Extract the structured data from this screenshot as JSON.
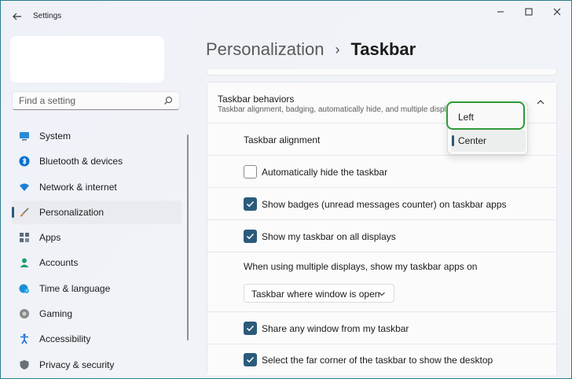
{
  "window": {
    "title": "Settings"
  },
  "search": {
    "placeholder": "Find a setting"
  },
  "sidebar": {
    "items": [
      {
        "label": "System",
        "icon": "monitor-icon",
        "color": "#0078d4"
      },
      {
        "label": "Bluetooth & devices",
        "icon": "bluetooth-icon",
        "color": "#0a6fd0"
      },
      {
        "label": "Network & internet",
        "icon": "wifi-icon",
        "color": "#1a7fd6"
      },
      {
        "label": "Personalization",
        "icon": "brush-icon",
        "color": "#d7742a",
        "active": true
      },
      {
        "label": "Apps",
        "icon": "apps-icon",
        "color": "#4d5b6b"
      },
      {
        "label": "Accounts",
        "icon": "person-icon",
        "color": "#1aa06a"
      },
      {
        "label": "Time & language",
        "icon": "globe-clock-icon",
        "color": "#1a8fd6"
      },
      {
        "label": "Gaming",
        "icon": "gamepad-icon",
        "color": "#6e6e6e"
      },
      {
        "label": "Accessibility",
        "icon": "accessibility-icon",
        "color": "#1a6fd6"
      },
      {
        "label": "Privacy & security",
        "icon": "shield-icon",
        "color": "#6b6f76"
      }
    ]
  },
  "breadcrumb": {
    "parent": "Personalization",
    "separator": "›",
    "current": "Taskbar"
  },
  "section": {
    "title": "Taskbar behaviors",
    "subtitle": "Taskbar alignment, badging, automatically hide, and multiple displays"
  },
  "rows": {
    "alignment_label": "Taskbar alignment",
    "auto_hide": {
      "label": "Automatically hide the taskbar",
      "checked": false
    },
    "badges": {
      "label": "Show badges (unread messages counter) on taskbar apps",
      "checked": true
    },
    "all_displays": {
      "label": "Show my taskbar on all displays",
      "checked": true
    },
    "multi_display_label": "When using multiple displays, show my taskbar apps on",
    "multi_display_value": "Taskbar where window is open",
    "share_window": {
      "label": "Share any window from my taskbar",
      "checked": true
    },
    "far_corner": {
      "label": "Select the far corner of the taskbar to show the desktop",
      "checked": true
    }
  },
  "flyout": {
    "options": [
      "Left",
      "Center"
    ],
    "selected": "Center"
  },
  "colors": {
    "accent": "#2b5b7a",
    "highlight_ring": "#2f9a3a"
  }
}
